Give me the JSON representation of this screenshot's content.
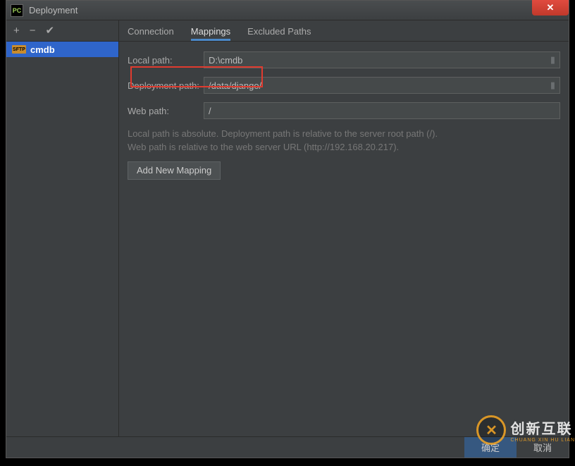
{
  "title": "Deployment",
  "sidebar": {
    "server_type": "SFTP",
    "server_name": "cmdb"
  },
  "tabs": {
    "connection": "Connection",
    "mappings": "Mappings",
    "excluded": "Excluded Paths"
  },
  "form": {
    "local_path_label": "Local path:",
    "local_path_value": "D:\\cmdb",
    "deployment_path_label": "Deployment path:",
    "deployment_path_value": "/data/django/",
    "web_path_label": "Web path:",
    "web_path_value": "/",
    "hint_line1": "Local path is absolute. Deployment path is relative to the server root path (/).",
    "hint_line2": "Web path is relative to the web server URL (http://192.168.20.217).",
    "add_button": "Add New Mapping"
  },
  "buttons": {
    "ok": "确定",
    "cancel": "取消"
  },
  "watermark": {
    "big": "创新互联",
    "small": "CHUANG XIN HU LIAN"
  }
}
